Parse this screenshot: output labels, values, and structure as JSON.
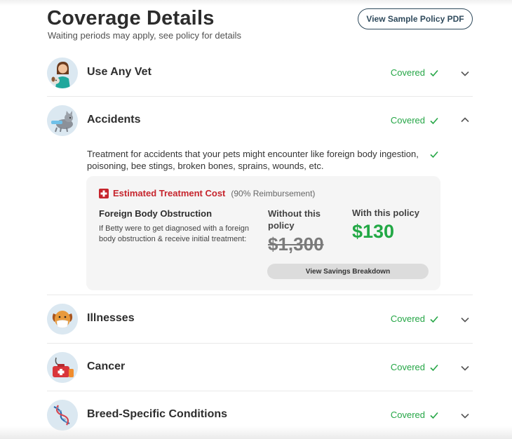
{
  "header": {
    "title": "Coverage Details",
    "subtitle": "Waiting periods may apply, see policy for details",
    "pdf_button": "View Sample Policy PDF"
  },
  "rows": [
    {
      "label": "Use Any Vet",
      "status": "Covered",
      "icon": "vet-with-dog-icon",
      "expanded": false
    },
    {
      "label": "Accidents",
      "status": "Covered",
      "icon": "cat-with-bandage-icon",
      "expanded": true
    },
    {
      "label": "Illnesses",
      "status": "Covered",
      "icon": "sick-dog-icon",
      "expanded": false
    },
    {
      "label": "Cancer",
      "status": "Covered",
      "icon": "medical-kit-icon",
      "expanded": false
    },
    {
      "label": "Breed-Specific Conditions",
      "status": "Covered",
      "icon": "dna-icon",
      "expanded": false
    }
  ],
  "accident_details": {
    "description": "Treatment for accidents that your pets might encounter like foreign body ingestion, poisoning, bee stings, broken bones, sprains, wounds, etc.",
    "cost_title": "Estimated Treatment Cost",
    "reimbursement": "(90% Reimbursement)",
    "condition_title": "Foreign Body Obstruction",
    "condition_desc": "If Betty were to get diagnosed with a foreign body obstruction & receive initial treatment:",
    "without_label": "Without this policy",
    "without_amount": "$1,300",
    "with_label": "With this policy",
    "with_amount": "$130",
    "savings_button": "View Savings Breakdown"
  },
  "colors": {
    "covered_green": "#25a646",
    "cost_red": "#c6252d",
    "button_border": "#2f4a5c",
    "card_bg": "#f5f5f5"
  }
}
